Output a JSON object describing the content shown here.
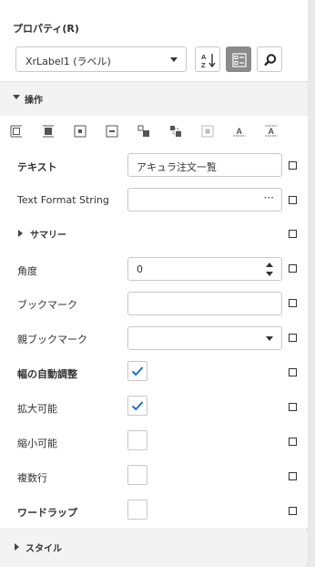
{
  "panel": {
    "title": "プロパティ(R)"
  },
  "selector": {
    "value": "XrLabel1 (ラベル)"
  },
  "toolbar": [
    {
      "name": "sort-alphabetical-button",
      "icon": "sort-az-icon",
      "active": false
    },
    {
      "name": "categorized-view-button",
      "icon": "categories-icon",
      "active": true
    },
    {
      "name": "search-button",
      "icon": "search-icon",
      "active": false
    }
  ],
  "sections": {
    "operations": "操作",
    "summary": "サマリー",
    "style": "スタイル"
  },
  "align_icons": [
    "align-left-icon",
    "align-center-horizontal-icon",
    "center-horizontally-icon",
    "center-vertically-icon",
    "size-to-content-icon",
    "size-to-grid-icon",
    "snap-to-grid-icon",
    "fit-text-icon",
    "fit-bounds-icon"
  ],
  "properties": {
    "text": {
      "label": "テキスト",
      "value": "アキュラ注文一覧"
    },
    "text_format": {
      "label": "Text Format String",
      "value": "",
      "button": "···"
    },
    "angle": {
      "label": "角度",
      "value": "0"
    },
    "bookmark": {
      "label": "ブックマーク",
      "value": ""
    },
    "parent_bookmark": {
      "label": "親ブックマーク",
      "value": ""
    },
    "auto_width": {
      "label": "幅の自動調整",
      "checked": true
    },
    "can_grow": {
      "label": "拡大可能",
      "checked": true
    },
    "can_shrink": {
      "label": "縮小可能",
      "checked": false
    },
    "multiline": {
      "label": "複数行",
      "checked": false
    },
    "word_wrap": {
      "label": "ワードラップ",
      "checked": false
    }
  },
  "colors": {
    "accent": "#1e6fc8",
    "active_button": "#8a8a8a"
  }
}
